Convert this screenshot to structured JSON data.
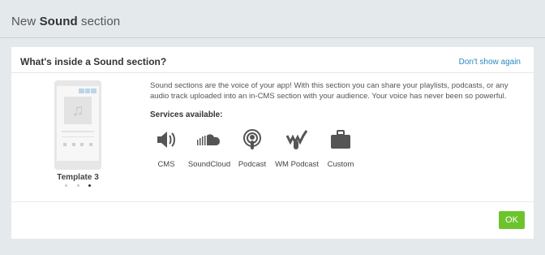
{
  "page": {
    "title_prefix": "New ",
    "title_bold": "Sound",
    "title_suffix": " section"
  },
  "card": {
    "heading": "What's inside a Sound section?",
    "dont_show_again": "Don't show again",
    "description": "Sound sections are the voice of your app! With this section you can share your playlists, podcasts, or any audio track uploaded into an in-CMS section with your audience. Your voice has never been so powerful.",
    "services_label": "Services available:",
    "services": [
      {
        "label": "CMS",
        "icon": "speaker-icon"
      },
      {
        "label": "SoundCloud",
        "icon": "soundcloud-icon"
      },
      {
        "label": "Podcast",
        "icon": "podcast-icon"
      },
      {
        "label": "WM Podcast",
        "icon": "wm-podcast-icon"
      },
      {
        "label": "Custom",
        "icon": "briefcase-icon"
      }
    ],
    "preview": {
      "template_label": "Template 3",
      "dots": 3,
      "active_dot": 3
    },
    "ok_button": "OK"
  },
  "colors": {
    "background": "#e4e9ec",
    "link": "#2a8ac4",
    "ok_button": "#6cc32c"
  }
}
